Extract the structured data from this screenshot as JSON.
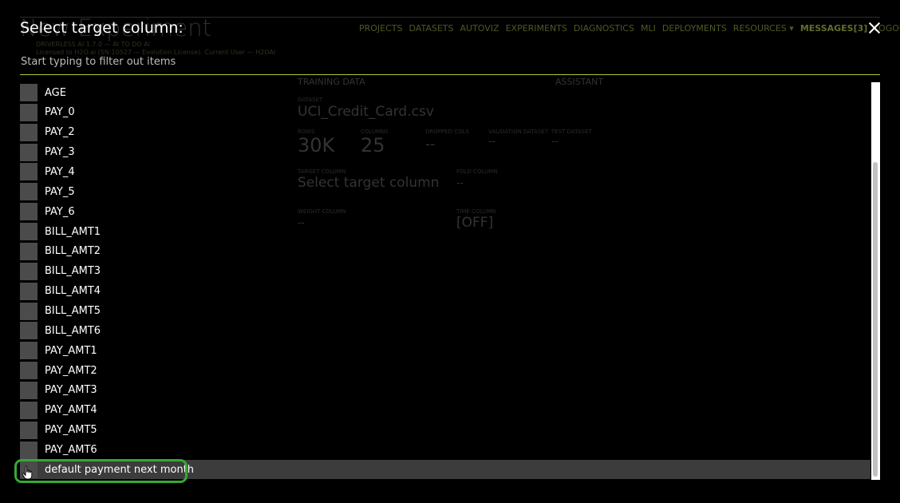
{
  "background": {
    "title": "New Experiment",
    "version": "DRIVERLESS AI 1.7.0 — AI TO DO AI",
    "license": "Licensed to H2O.ai (SN:10527 — Evolution License). Current User — H2OAI",
    "nav": [
      "PROJECTS",
      "DATASETS",
      "AUTOVIZ",
      "EXPERIMENTS",
      "DIAGNOSTICS",
      "MLI",
      "DEPLOYMENTS",
      "RESOURCES ▾",
      "MESSAGES[3]",
      "LOGOUT"
    ],
    "training_data": {
      "heading": "TRAINING DATA",
      "assistant": "ASSISTANT",
      "dataset_label": "DATASET",
      "dataset_value": "UCI_Credit_Card.csv",
      "rows_label": "ROWS",
      "rows_value": "30K",
      "columns_label": "COLUMNS",
      "columns_value": "25",
      "dropped_label": "DROPPED COLS",
      "dropped_value": "--",
      "validation_label": "VALIDATION DATASET",
      "validation_value": "--",
      "test_label": "TEST DATASET",
      "test_value": "--",
      "target_label": "TARGET COLUMN",
      "target_value": "Select target column",
      "fold_label": "FOLD COLUMN",
      "fold_value": "--",
      "weight_label": "WEIGHT COLUMN",
      "weight_value": "--",
      "time_label": "TIME COLUMN",
      "time_value": "[OFF]"
    }
  },
  "modal": {
    "title": "Select target column:",
    "filter_placeholder": "Start typing to filter out items",
    "items": [
      {
        "label": "AGE"
      },
      {
        "label": "PAY_0"
      },
      {
        "label": "PAY_2"
      },
      {
        "label": "PAY_3"
      },
      {
        "label": "PAY_4"
      },
      {
        "label": "PAY_5"
      },
      {
        "label": "PAY_6"
      },
      {
        "label": "BILL_AMT1"
      },
      {
        "label": "BILL_AMT2"
      },
      {
        "label": "BILL_AMT3"
      },
      {
        "label": "BILL_AMT4"
      },
      {
        "label": "BILL_AMT5"
      },
      {
        "label": "BILL_AMT6"
      },
      {
        "label": "PAY_AMT1"
      },
      {
        "label": "PAY_AMT2"
      },
      {
        "label": "PAY_AMT3"
      },
      {
        "label": "PAY_AMT4"
      },
      {
        "label": "PAY_AMT5"
      },
      {
        "label": "PAY_AMT6"
      },
      {
        "label": "default payment next month"
      }
    ],
    "highlighted_item": "default payment next month"
  },
  "colors": {
    "accent": "#a8c832",
    "highlight_ring": "#35a835"
  }
}
